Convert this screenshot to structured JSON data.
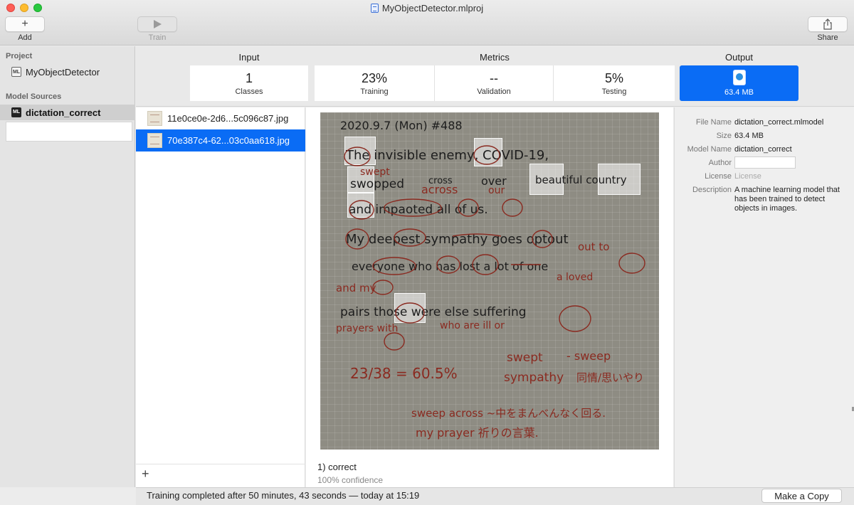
{
  "window": {
    "title": "MyObjectDetector.mlproj"
  },
  "toolbar": {
    "add_label": "Add",
    "train_label": "Train",
    "share_label": "Share"
  },
  "sidebar": {
    "project_header": "Project",
    "project_name": "MyObjectDetector",
    "sources_header": "Model Sources",
    "source_name": "dictation_correct",
    "icon_text": "ML"
  },
  "header": {
    "input_title": "Input",
    "metrics_title": "Metrics",
    "output_title": "Output",
    "classes": {
      "value": "1",
      "label": "Classes"
    },
    "training": {
      "value": "23%",
      "label": "Training"
    },
    "validation": {
      "value": "--",
      "label": "Validation"
    },
    "testing": {
      "value": "5%",
      "label": "Testing"
    },
    "output": {
      "size": "63.4 MB",
      "icon": "mlmodel-file-icon"
    }
  },
  "files": [
    {
      "name": "11e0ce0e-2d6...5c096c87.jpg",
      "selected": false
    },
    {
      "name": "70e387c4-62...03c0aa618.jpg",
      "selected": true
    }
  ],
  "preview": {
    "handwriting": {
      "line1": "2020.9.7 (Mon) #488",
      "line2": "The invisible enemy, COVID-19,",
      "line3a": "swopped",
      "line3b": "cross",
      "line3c": "over",
      "line3d": "beautiful country",
      "line3red1": "swept",
      "line3red2": "across",
      "line3red3": "our",
      "line4": "and impaoted all of us.",
      "line5": "My deepest sympathy goes optout",
      "line5red": "out to",
      "line6": "everyone who has lost a lot of one",
      "line6red": "a loved",
      "line7red": "and my",
      "line8": "pairs those were else suffering",
      "line8red1": "prayers with",
      "line8red2": "who are ill or",
      "score": "23/38 = 60.5%",
      "note1a": "swept",
      "note1b": "- sweep",
      "note2a": "sympathy",
      "note2b": "同情/思いやり",
      "note3": "sweep across ~中をまんべんなく回る.",
      "note4": "my prayer 祈りの言葉."
    },
    "result_label": "1) correct",
    "result_confidence": "100% confidence"
  },
  "info": {
    "file_name_key": "File Name",
    "file_name": "dictation_correct.mlmodel",
    "size_key": "Size",
    "size": "63.4 MB",
    "model_name_key": "Model Name",
    "model_name": "dictation_correct",
    "author_key": "Author",
    "author": "",
    "license_key": "License",
    "license": "License",
    "description_key": "Description",
    "description": "A machine learning model that has been trained to detect objects in images."
  },
  "status": {
    "text": "Training completed after 50 minutes, 43 seconds — today at 15:19",
    "copy_button": "Make a Copy"
  },
  "colors": {
    "accent": "#0a6cf5",
    "ink": "#1d1d1d",
    "red_pen": "#8a2a20",
    "paper": "#8e8c83"
  }
}
